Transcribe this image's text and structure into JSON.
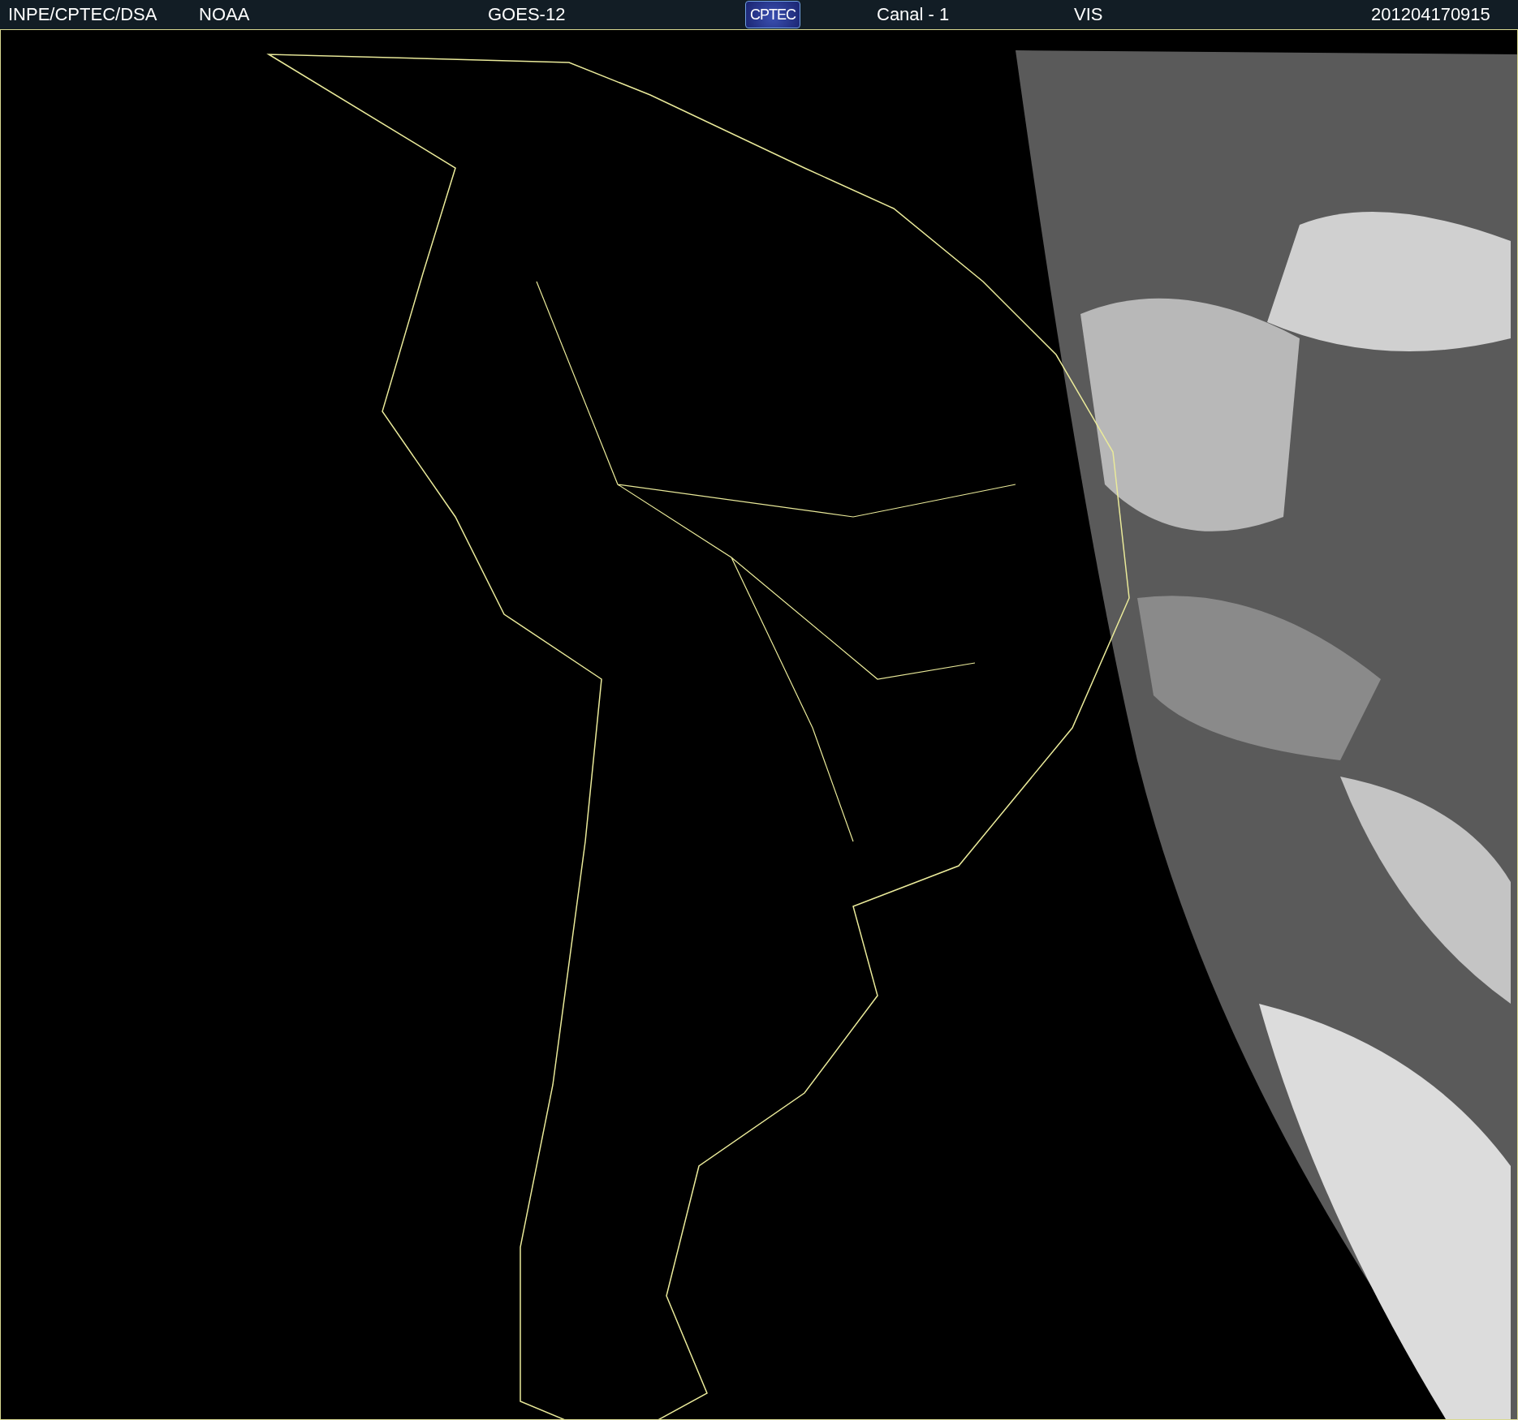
{
  "header": {
    "source": "INPE/CPTEC/DSA",
    "agency": "NOAA",
    "satellite": "GOES-12",
    "logo": "CPTEC",
    "channel": "Canal - 1",
    "band": "VIS",
    "timestamp": "201204170915"
  }
}
